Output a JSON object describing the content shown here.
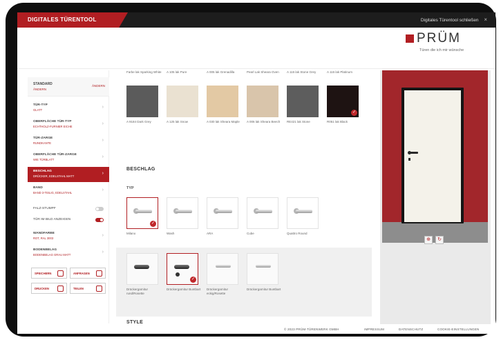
{
  "app": {
    "title": "DIGITALES TÜRENTOOL",
    "save_label": "Digitales Türentool schließen",
    "close_icon": "×"
  },
  "logo": {
    "name": "PRÜM",
    "claim": "Türen die ich mir wünsche"
  },
  "sidebar": {
    "head": {
      "label": "STANDARD",
      "sub": "ÄNDERN",
      "action": "ÄNDERN"
    },
    "items": [
      {
        "label": "TÜR-TYP",
        "sub": "GLATT"
      },
      {
        "label": "OBERFLÄCHE TÜR-TYP",
        "sub": "ECHTHOLZ-FURNIER EICHE"
      },
      {
        "label": "TÜR-ZARGE",
        "sub": "RUNDKANTE"
      },
      {
        "label": "OBERFLÄCHE TÜR-ZARGE",
        "sub": "WIE TÜRBLATT"
      },
      {
        "label": "BESCHLAG",
        "sub": "DRÜCKER, EDELSTAHL MATT"
      },
      {
        "label": "BAND",
        "sub": "BAND 3-TEILIG, EDELSTAHL"
      }
    ],
    "toggles": [
      {
        "label": "FALZ-STUMPF",
        "on": false
      },
      {
        "label": "TÜR IM BILD ANZEIGEN",
        "on": true
      }
    ],
    "items2": [
      {
        "label": "WANDFARBE",
        "sub": "ROT, RAL 3003"
      },
      {
        "label": "BODENBELAG",
        "sub": "BODENBELAG GRAU MATT"
      }
    ],
    "buttons": [
      "SPEICHERN",
      "ANFRAGEN",
      "DRUCKEN",
      "TEILEN"
    ]
  },
  "materials": [
    {
      "cap": "Farbe lak Sparking White",
      "label": "A 9184 Dark Grey",
      "color": "#5b5b5b"
    },
    {
      "cap": "A 105 lak Pure",
      "label": "A 125 lak Snow",
      "color": "#eae1d1"
    },
    {
      "cap": "A 005 lak Grenadilla",
      "label": "A 030 lak Sheara Maple",
      "color": "#e3c9a4"
    },
    {
      "cap": "Pearl Lak Sheara Oven",
      "label": "A 006 lak Sheara Beech",
      "color": "#d9c5ab"
    },
    {
      "cap": "A 115 lak Stone Grey",
      "label": "RE421 lak Stone",
      "color": "#5d5d5d"
    },
    {
      "cap": "A 115 lak Platinum",
      "label": "R051 lak Black",
      "color": "#1e1312"
    }
  ],
  "beschlag": {
    "title": "BESCHLAG",
    "sub": "TYP",
    "handles": [
      "Milano",
      "Wash",
      "ARA",
      "Cube",
      "Quattro Round"
    ],
    "row2": [
      "Drückergarnitur rund/Rosette",
      "Drückergarnitur Buntbart",
      "Drückergarnitur eckig/Rosette",
      "Drückergarnitur Buntbart"
    ]
  },
  "style": {
    "title": "STYLE"
  },
  "footer": {
    "copyright": "© 2023 PRÜM-TÜRENWERK GMBH",
    "links": [
      "IMPRESSUM",
      "DATENSCHUTZ",
      "COOKIE-EINSTELLUNGEN"
    ]
  },
  "colors": {
    "brand": "#b11e22",
    "topbar": "#1d1d1d",
    "wall": "#a2262b"
  }
}
